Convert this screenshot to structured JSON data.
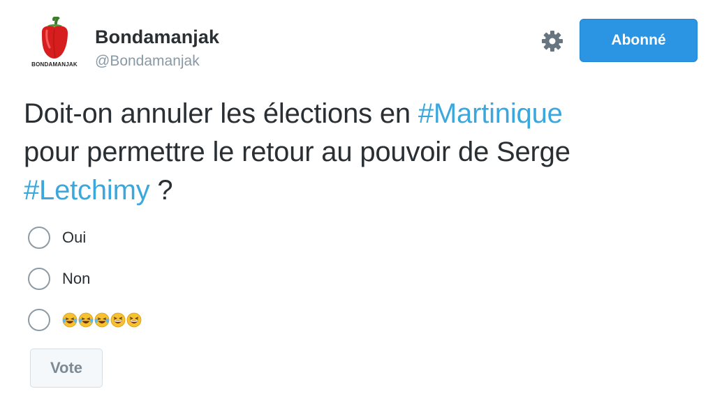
{
  "author": {
    "display_name": "Bondamanjak",
    "handle": "@Bondamanjak",
    "avatar_caption": "BONDAMANJAK",
    "avatar_icon": "red-pepper-icon"
  },
  "header": {
    "settings_icon": "gear-icon",
    "follow_label": "Abonné"
  },
  "tweet": {
    "segments": [
      {
        "text": "Doit-on annuler les élections en "
      },
      {
        "text": "#Martinique"
      },
      {
        "text": "pour permettre le retour au pouvoir de Serge "
      },
      {
        "text": "#Letchimy"
      },
      {
        "text": " ?"
      }
    ]
  },
  "poll": {
    "options": [
      {
        "label": "Oui"
      },
      {
        "label": "Non"
      },
      {
        "label": "😂😂😂😆😆",
        "icons": [
          "laughing-tears-emoji-icon",
          "laughing-tears-emoji-icon",
          "laughing-tears-emoji-icon",
          "grinning-squint-emoji-icon",
          "grinning-squint-emoji-icon"
        ]
      }
    ],
    "vote_label": "Vote"
  },
  "colors": {
    "hashtag": "#3ba8dd",
    "follow_button": "#2b94e3",
    "text": "#292f33",
    "muted": "#8899a6"
  }
}
